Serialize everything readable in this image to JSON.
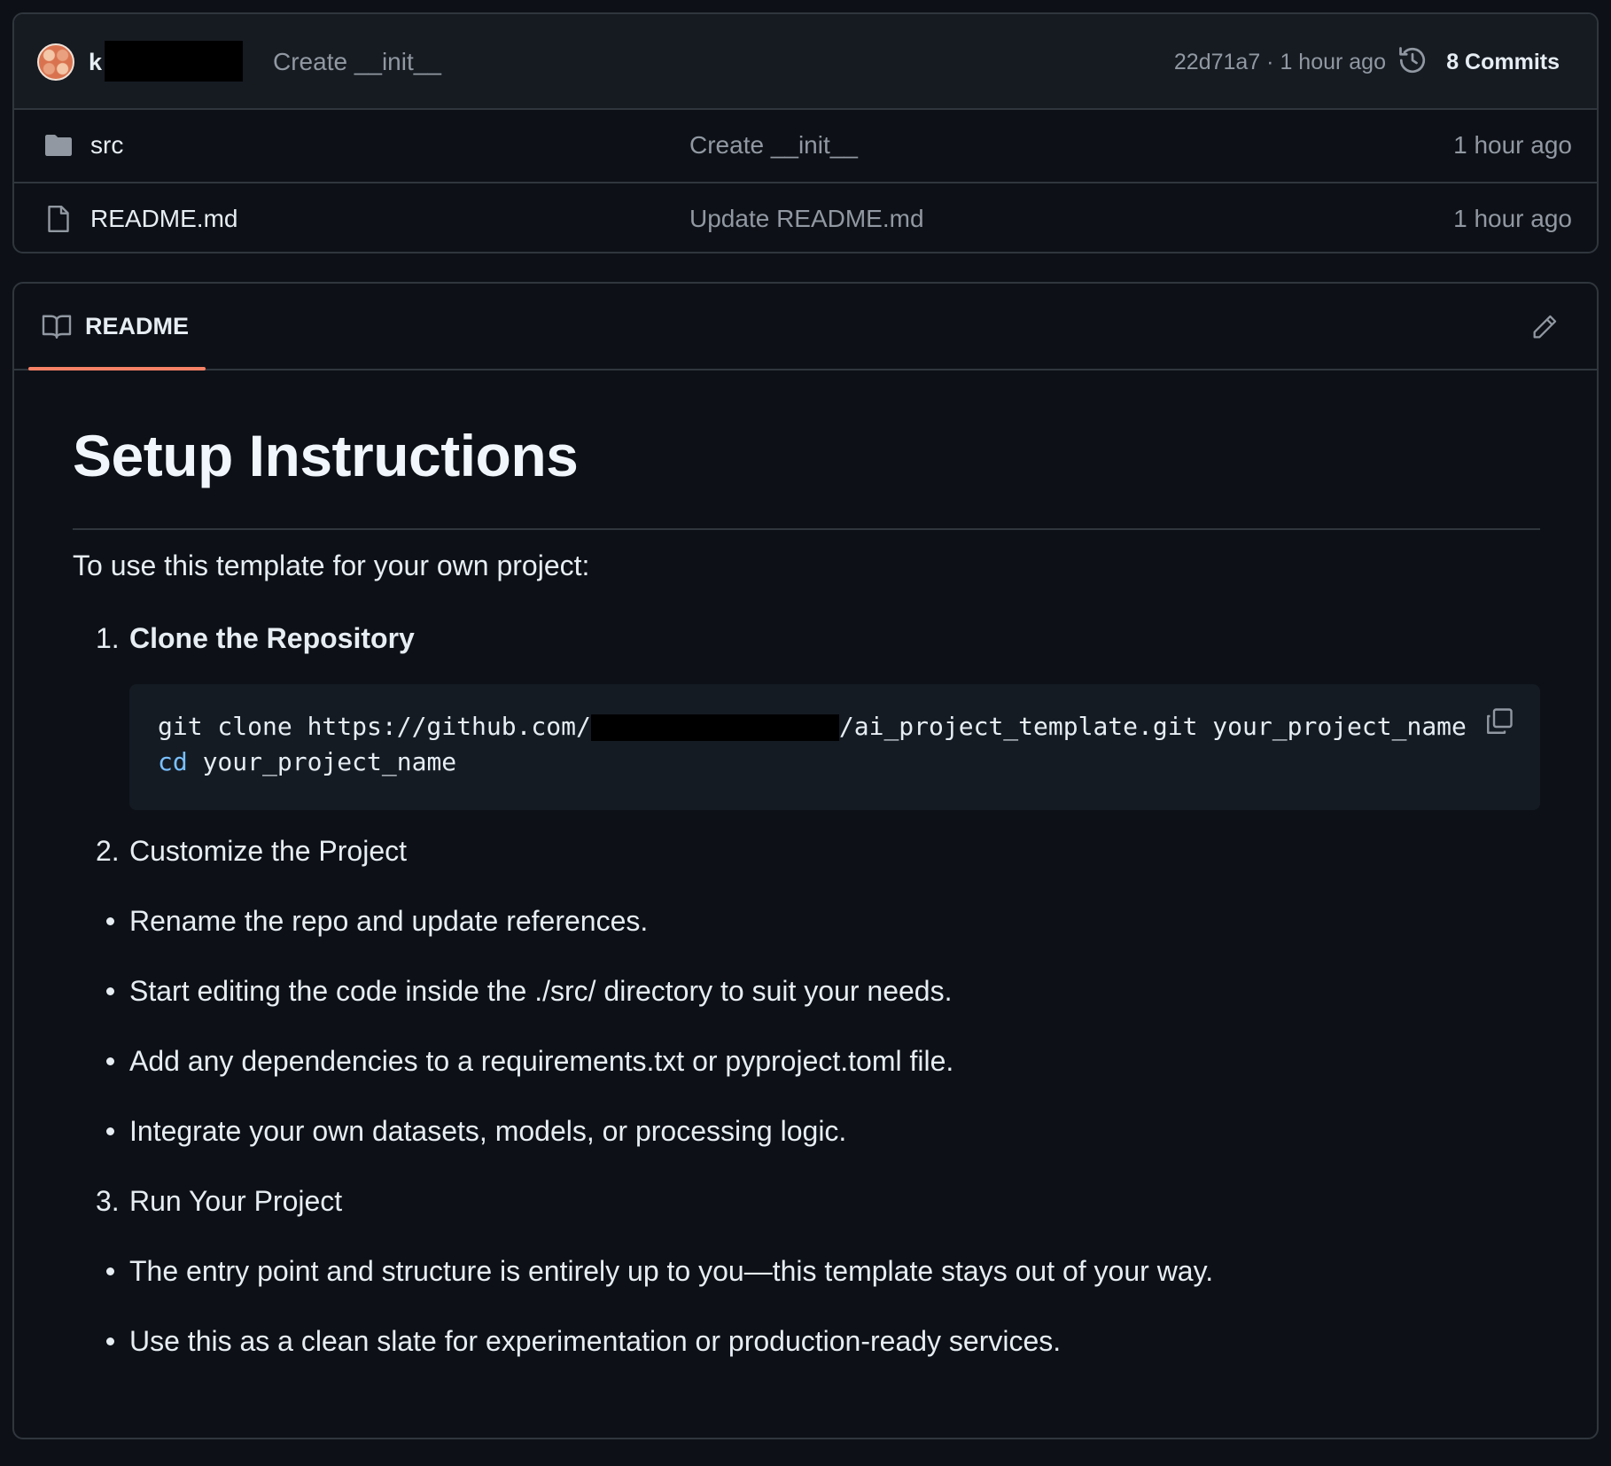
{
  "commit_bar": {
    "author_visible": "k",
    "message": "Create __init__",
    "meta": "22d71a7 · 1 hour ago",
    "commits_label": "8 Commits"
  },
  "files": [
    {
      "icon": "folder-icon",
      "name": "src",
      "commit": "Create __init__",
      "time": "1 hour ago"
    },
    {
      "icon": "file-icon",
      "name": "README.md",
      "commit": "Update README.md",
      "time": "1 hour ago"
    }
  ],
  "readme": {
    "tab_label": "README",
    "title": "Setup Instructions",
    "intro": "To use this template for your own project:",
    "step1": {
      "num": "1.",
      "label": "Clone the Repository"
    },
    "code": {
      "line1_prefix": "git clone https://github.com/",
      "line1_suffix": "/ai_project_template.git your_project_name",
      "line2_cmd": "cd",
      "line2_arg": " your_project_name"
    },
    "step2": {
      "num": "2.",
      "label": "Customize the Project"
    },
    "step2_bullets": [
      "Rename the repo and update references.",
      "Start editing the code inside the ./src/ directory to suit your needs.",
      "Add any dependencies to a requirements.txt or pyproject.toml file.",
      "Integrate your own datasets, models, or processing logic."
    ],
    "step3": {
      "num": "3.",
      "label": "Run Your Project"
    },
    "step3_bullets": [
      "The entry point and structure is entirely up to you—this template stays out of your way.",
      "Use this as a clean slate for experimentation or production-ready services."
    ]
  },
  "colors": {
    "background": "#0d1117",
    "border": "#30363d",
    "muted_text": "#9198a1",
    "tab_accent": "#f78166",
    "code_keyword": "#79c0ff"
  }
}
